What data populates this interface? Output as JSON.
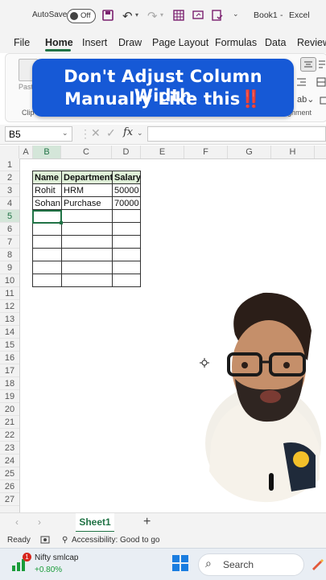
{
  "titlebar": {
    "autosave_label": "AutoSave",
    "autosave_state": "Off",
    "title": "Book1",
    "app": "Excel",
    "separator": "-"
  },
  "ribbon": {
    "tabs": [
      "File",
      "Home",
      "Insert",
      "Draw",
      "Page Layout",
      "Formulas",
      "Data",
      "Review"
    ],
    "active_tab": "Home",
    "paste_label": "Past",
    "clipboard_label": "Clip",
    "alignment_label": "lignment"
  },
  "banner": {
    "line1": "Don't Adjust Column Width",
    "line2": "Manually Like this",
    "emoji": "‼️"
  },
  "formula_bar": {
    "name_box": "B5",
    "fx_label": "fx",
    "formula": ""
  },
  "sheet": {
    "columns": [
      "A",
      "B",
      "C",
      "D",
      "E",
      "F",
      "G",
      "H"
    ],
    "rows": [
      "1",
      "2",
      "3",
      "4",
      "5",
      "6",
      "7",
      "8",
      "9",
      "10",
      "11",
      "12",
      "13",
      "14",
      "15",
      "16",
      "17",
      "18",
      "19",
      "20",
      "21",
      "22",
      "23",
      "24",
      "25",
      "26",
      "27"
    ],
    "table": {
      "headers": [
        "Name",
        "Department",
        "Salary"
      ],
      "rows": [
        [
          "Rohit",
          "HRM",
          "50000"
        ],
        [
          "Sohan",
          "Purchase",
          "70000"
        ],
        [
          "",
          "",
          ""
        ],
        [
          "",
          "",
          ""
        ],
        [
          "",
          "",
          ""
        ],
        [
          "",
          "",
          ""
        ],
        [
          "",
          "",
          ""
        ],
        [
          "",
          "",
          ""
        ]
      ]
    }
  },
  "sheet_tabs": {
    "active": "Sheet1",
    "add": "+"
  },
  "status": {
    "ready": "Ready",
    "accessibility": "Accessibility: Good to go"
  },
  "taskbar": {
    "widget_name": "Nifty smlcap",
    "widget_value": "+0.80%",
    "badge": "1",
    "search": "Search"
  },
  "colors": {
    "banner": "#1659d6",
    "header_fill": "#dff0d8",
    "excel_green": "#217346"
  }
}
